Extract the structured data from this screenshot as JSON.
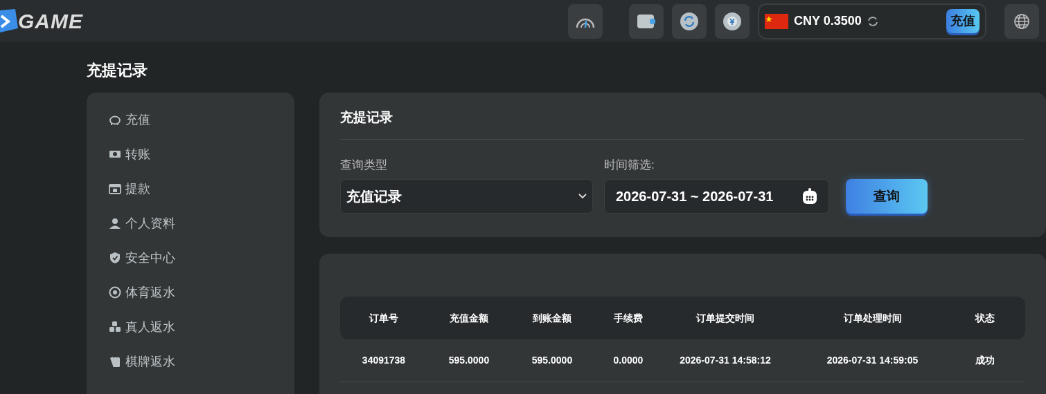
{
  "header": {
    "logo": "GAME",
    "balance": {
      "currency": "CNY 0.3500"
    },
    "deposit_button": "充值"
  },
  "page_title": "充提记录",
  "sidebar": {
    "items": [
      {
        "label": "充值"
      },
      {
        "label": "转账"
      },
      {
        "label": "提款"
      },
      {
        "label": "个人资料"
      },
      {
        "label": "安全中心"
      },
      {
        "label": "体育返水"
      },
      {
        "label": "真人返水"
      },
      {
        "label": "棋牌返水"
      }
    ]
  },
  "filter": {
    "title": "充提记录",
    "type_label": "查询类型",
    "type_value": "充值记录",
    "time_label": "时间筛选:",
    "time_value": "2026-07-31 ~ 2026-07-31",
    "search_button": "查询"
  },
  "table": {
    "columns": [
      "订单号",
      "充值金额",
      "到账金额",
      "手续费",
      "订单提交时间",
      "订单处理时间",
      "状态"
    ],
    "rows": [
      [
        "34091738",
        "595.0000",
        "595.0000",
        "0.0000",
        "2026-07-31 14:58:12",
        "2026-07-31 14:59:05",
        "成功"
      ]
    ]
  }
}
